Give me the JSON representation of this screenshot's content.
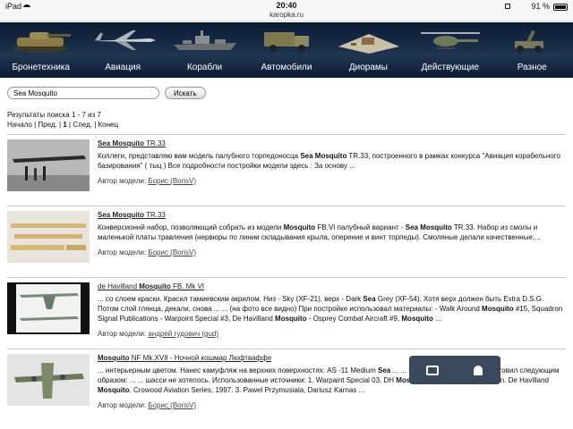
{
  "status_bar": {
    "device": "iPad",
    "time": "20:40",
    "url": "karopka.ru",
    "battery": "91 %"
  },
  "categories": [
    {
      "label": "Бронетехника",
      "icon": "tank-icon"
    },
    {
      "label": "Авиация",
      "icon": "jet-icon"
    },
    {
      "label": "Корабли",
      "icon": "ship-icon"
    },
    {
      "label": "Автомобили",
      "icon": "truck-icon"
    },
    {
      "label": "Диорамы",
      "icon": "diorama-icon"
    },
    {
      "label": "Действующие",
      "icon": "helicopter-icon"
    },
    {
      "label": "Разное",
      "icon": "artillery-icon"
    }
  ],
  "search": {
    "value": "Sea Mosquito",
    "button": "Искать"
  },
  "results_meta": {
    "summary": "Результаты поиска 1 - 7 из 7",
    "pager": {
      "start": "Начало",
      "prev": "Пред.",
      "current": "1",
      "next": "След.",
      "end": "Конец"
    }
  },
  "results": [
    {
      "title_html": "<b>Sea Mosquito</b> TR.33",
      "desc_html": "Коллеги, представляю вам модель палубного торпедоносца <b>Sea Mosquito</b> TR.33, построенного в рамках конкурса \"Авиация корабельного базирования\" ( тыц ) Все подробности постройки модели здесь : За основу ...",
      "author_label": "Автор модели:",
      "author": "Борис (BorisV)"
    },
    {
      "title_html": "<b>Sea Mosquito</b> TR.33",
      "desc_html": "Конверсионнй набор, позволяющий собрать из модели <b>Mosquito</b> FB.VI палубный вариант - <b>Sea Mosquito</b> TR.33. Набор из смолы и маленькой платы травления (нервюры по линии складывания крыла, оперение и винт торпеды). Смоляные делали качественные,...",
      "author_label": "Автор модели:",
      "author": "Борис (BorisV)"
    },
    {
      "title_html": "de Havilland <b>Mosquito</b> FB. Mk VI",
      "desc_html": "... со слоем краски. Красил тамиевским акрилом. Низ - Sky (XF-21), верх - Dark <b>Sea</b> Grey (XF-54). Хотя верх должен быть Extra D.S.G. Потом слой глянца, декали, снова ... ... (на фото все видно) При постройке использовал материалы: - Walk Around <b>Mosquito</b> #15, Squadron Signal Publications - Warpoint Special #3, De Havilland <b>Mosquito</b> - Osprey Combat Aircraft #9, <b>Mosquito</b> ...",
      "author_label": "Автор модели:",
      "author": "андрей гудович (gud)"
    },
    {
      "title_html": "<b>Mosquito</b> NF Mk.XVII - Ночной кошмар Люфтваффе",
      "desc_html": "... интерьерным цветом. Нанес камуфляж на верхних поверхностях: AS -11 Medium <b>Sea</b> ... ... Маски на обе машины изготовил следующим образом: ... ... шасси не хотелось. Использованные источники: 1. Warpaint Special 03. DH <b>Mosquito</b> . 2. Martin W . Bowman. De Havilland <b>Mosquito</b>. Crowood Aviation Series, 1997. 3. Pawel Przymusiala, Dariusz Karnas ...",
      "author_label": "Автор модели:",
      "author": "Борис (BorisV)"
    }
  ],
  "widget": {
    "chat_icon": "chat-icon",
    "bell_icon": "bell-icon"
  }
}
